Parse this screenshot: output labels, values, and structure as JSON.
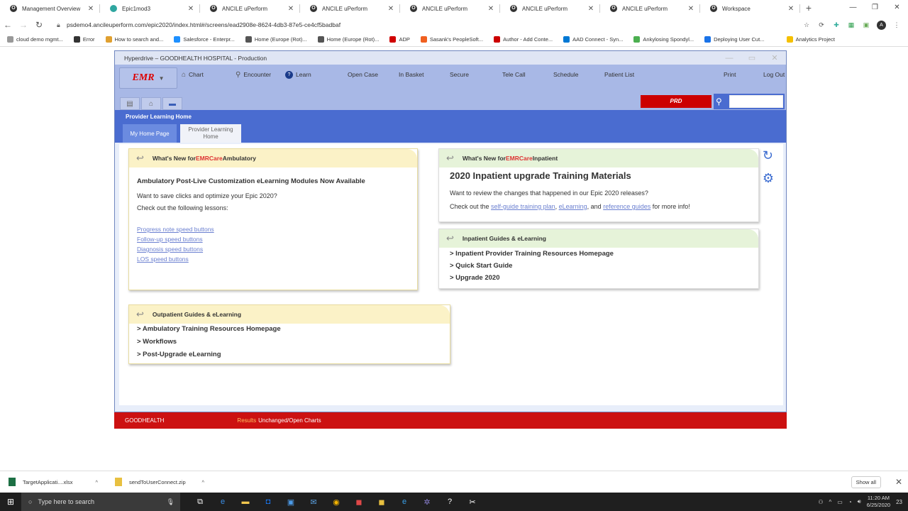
{
  "browser": {
    "tabs": [
      {
        "label": "Management Overview",
        "icon": "ancile-icon"
      },
      {
        "label": "Epic1mod3",
        "icon": "cloud-icon"
      },
      {
        "label": "ANCILE uPerform",
        "icon": "ancile-icon"
      },
      {
        "label": "ANCILE uPerform",
        "icon": "ancile-icon"
      },
      {
        "label": "ANCILE uPerform",
        "icon": "ancile-icon"
      },
      {
        "label": "ANCILE uPerform",
        "icon": "ancile-icon"
      },
      {
        "label": "ANCILE uPerform",
        "icon": "ancile-icon"
      },
      {
        "label": "Workspace",
        "icon": "ancile-icon"
      }
    ],
    "url": "psdemo4.ancileuperform.com/epic2020/index.html#/screens/ead2908e-8624-4db3-87e5-ce4cf5badbaf",
    "bookmarks": [
      {
        "label": "cloud demo mgmt...",
        "color": "#999999"
      },
      {
        "label": "Error",
        "color": "#333333"
      },
      {
        "label": "How to search and...",
        "color": "#e0a030"
      },
      {
        "label": "Salesforce - Enterpr...",
        "color": "#1e90ff"
      },
      {
        "label": "Home (Europe (Rot)...",
        "color": "#555555"
      },
      {
        "label": "Home (Europe (Rot)...",
        "color": "#555555"
      },
      {
        "label": "ADP",
        "color": "#d00000"
      },
      {
        "label": "Sasank's PeopleSoft...",
        "color": "#f06020"
      },
      {
        "label": "Author - Add Conte...",
        "color": "#cc0000"
      },
      {
        "label": "AAD Connect - Syn...",
        "color": "#0078d4"
      },
      {
        "label": "Ankylosing Spondyl...",
        "color": "#4caf50"
      },
      {
        "label": "Deploying User Cut...",
        "color": "#1a73e8"
      }
    ],
    "bookmark_right": {
      "label": "Analytics Project",
      "color": "#f5c000"
    }
  },
  "app": {
    "title": "Hyperdrive – GOODHEALTH  HOSPITAL - Production",
    "logo": "EMR",
    "toolbar": [
      {
        "label": "Chart",
        "icon": "house-icon",
        "glyph": "⌂"
      },
      {
        "label": "Encounter",
        "icon": "person-icon",
        "glyph": "⚲"
      },
      {
        "label": "Learn",
        "icon": "question-icon",
        "glyph": "?"
      },
      {
        "label": "Open Case"
      },
      {
        "label": "In Basket"
      },
      {
        "label": "Secure"
      },
      {
        "label": "Tele Call"
      },
      {
        "label": "Schedule"
      },
      {
        "label": "Patient List"
      },
      {
        "label": "Print"
      },
      {
        "label": "Log Out"
      }
    ],
    "env_badge": "PRD",
    "activity_title": "Provider Learning Home",
    "tabs": [
      "My Home Page",
      "Provider Learning Home"
    ]
  },
  "cards": {
    "ambulatory": {
      "header_prefix": "What's New for ",
      "header_hl": "EMRCare",
      "header_suffix": " Ambulatory",
      "title": "Ambulatory Post-Live Customization eLearning Modules Now Available",
      "line1": "Want to save clicks and optimize your Epic 2020?",
      "line2": "Check out the following lessons:",
      "links": [
        "Progress note speed buttons",
        "Follow-up speed buttons",
        "Diagnosis speed buttons",
        "LOS speed buttons"
      ]
    },
    "inpatient": {
      "header_prefix": "What's New for ",
      "header_hl": "EMRCare",
      "header_suffix": " Inpatient",
      "title": "2020 Inpatient upgrade Training Materials",
      "line1": "Want to review the changes that happened in our Epic 2020 releases?",
      "line2_prefix": "Check out the ",
      "link1": "self-guide training plan",
      "sep1": ", ",
      "link2": "eLearning",
      "sep2": ", and ",
      "link3": "reference guides",
      "line2_suffix": " for more info!"
    },
    "inpatient_guides": {
      "header": "Inpatient Guides & eLearning",
      "items": [
        "> Inpatient Provider Training Resources Homepage",
        "> Quick Start Guide",
        "> Upgrade 2020"
      ]
    },
    "outpatient_guides": {
      "header": "Outpatient Guides & eLearning",
      "items": [
        "> Ambulatory Training Resources Homepage",
        "> Workflows",
        "> Post-Upgrade eLearning"
      ]
    }
  },
  "footer": {
    "org": "GOODHEALTH",
    "results": "Results",
    "status": "Unchanged/Open Charts"
  },
  "downloads": [
    {
      "label": "TargetApplicati....xlsx",
      "color": "#1d7044"
    },
    {
      "label": "sendToUserConnect.zip",
      "color": "#e8c040"
    }
  ],
  "downloads_show_all": "Show all",
  "taskbar": {
    "search_placeholder": "Type here to search",
    "time": "11:20 AM",
    "date": "6/25/2020",
    "notifications": "23"
  }
}
